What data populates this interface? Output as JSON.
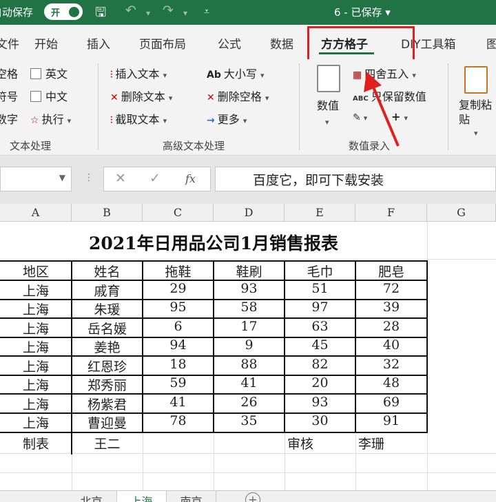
{
  "titlebar": {
    "autosave_label": "自动保存",
    "toggle_label": "开",
    "document_title": "6 - 已保存"
  },
  "ribbon_tabs": [
    "文件",
    "开始",
    "插入",
    "页面布局",
    "公式",
    "数据",
    "方方格子",
    "DIY工具箱",
    "图"
  ],
  "active_tab": "方方格子",
  "ribbon": {
    "text_group": {
      "items": [
        "空格",
        "符号",
        "数字"
      ],
      "checks": [
        "英文",
        "中文"
      ],
      "execute": "执行",
      "label": "文本处理"
    },
    "adv_text_group": {
      "insert_text": "插入文本",
      "delete_text": "删除文本",
      "truncate_text": "截取文本",
      "case": "大小写",
      "delete_space": "删除空格",
      "more": "更多",
      "label": "高级文本处理"
    },
    "value_group": {
      "value": "数值",
      "round": "四舍五入",
      "keep_value": "只保留数值",
      "plus": "+",
      "label": "数值录入"
    },
    "clipboard_group": {
      "copy_paste": "复制粘贴"
    }
  },
  "formula_bar": {
    "content": "百度它，即可下载安装"
  },
  "column_headers": [
    "A",
    "B",
    "C",
    "D",
    "E",
    "F",
    "G"
  ],
  "sheet": {
    "title": "2021年日用品公司1月销售报表",
    "headers": [
      "地区",
      "姓名",
      "拖鞋",
      "鞋刷",
      "毛巾",
      "肥皂"
    ],
    "rows": [
      [
        "上海",
        "戚育",
        "29",
        "93",
        "51",
        "72"
      ],
      [
        "上海",
        "朱瑗",
        "95",
        "58",
        "97",
        "39"
      ],
      [
        "上海",
        "岳名媛",
        "6",
        "17",
        "63",
        "28"
      ],
      [
        "上海",
        "姜艳",
        "94",
        "9",
        "45",
        "40"
      ],
      [
        "上海",
        "红恩珍",
        "18",
        "88",
        "82",
        "32"
      ],
      [
        "上海",
        "郑秀丽",
        "59",
        "41",
        "20",
        "48"
      ],
      [
        "上海",
        "杨紫君",
        "41",
        "26",
        "93",
        "69"
      ],
      [
        "上海",
        "曹迎曼",
        "78",
        "35",
        "30",
        "91"
      ]
    ],
    "footer": {
      "maker_label": "制表",
      "maker_name": "王二",
      "reviewer_label": "审核",
      "reviewer_name": "李珊"
    }
  },
  "sheet_tabs": [
    "北京",
    "上海",
    "南京"
  ],
  "active_sheet": "上海",
  "colors": {
    "accent": "#217346",
    "highlight": "#e02020"
  }
}
